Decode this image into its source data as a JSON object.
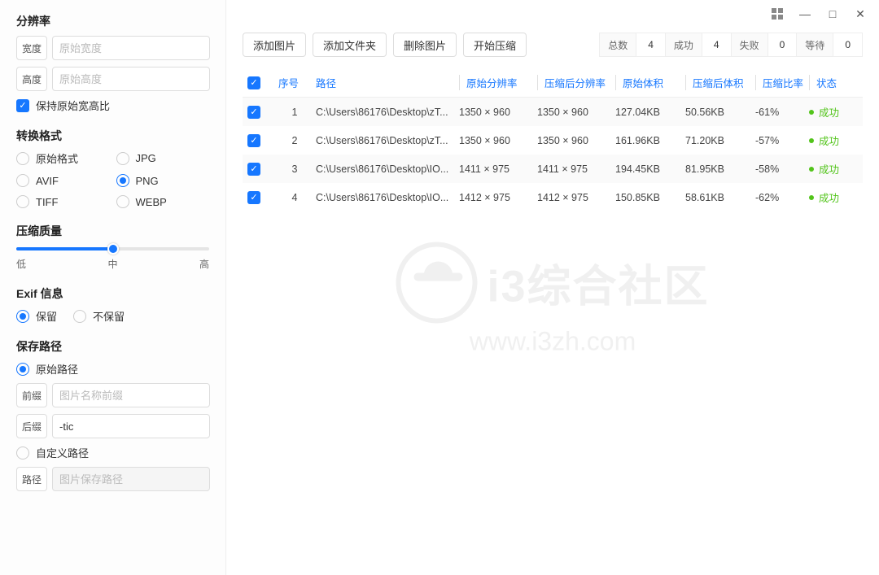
{
  "sidebar": {
    "resolution": {
      "title": "分辨率",
      "width_label": "宽度",
      "width_placeholder": "原始宽度",
      "height_label": "高度",
      "height_placeholder": "原始高度",
      "keep_ratio": "保持原始宽高比"
    },
    "format": {
      "title": "转换格式",
      "options": [
        "原始格式",
        "JPG",
        "AVIF",
        "PNG",
        "TIFF",
        "WEBP"
      ],
      "selected": "PNG"
    },
    "quality": {
      "title": "压缩质量",
      "low": "低",
      "mid": "中",
      "high": "高"
    },
    "exif": {
      "title": "Exif 信息",
      "keep": "保留",
      "discard": "不保留",
      "selected": "保留"
    },
    "save": {
      "title": "保存路径",
      "original": "原始路径",
      "prefix_label": "前缀",
      "prefix_placeholder": "图片名称前缀",
      "suffix_label": "后缀",
      "suffix_value": "-tic",
      "custom": "自定义路径",
      "path_label": "路径",
      "path_placeholder": "图片保存路径",
      "selected": "原始路径"
    }
  },
  "toolbar": {
    "add_image": "添加图片",
    "add_folder": "添加文件夹",
    "delete_image": "删除图片",
    "start": "开始压缩"
  },
  "stats": {
    "total_label": "总数",
    "total_val": "4",
    "success_label": "成功",
    "success_val": "4",
    "fail_label": "失败",
    "fail_val": "0",
    "wait_label": "等待",
    "wait_val": "0"
  },
  "table": {
    "headers": {
      "index": "序号",
      "path": "路径",
      "orig_res": "原始分辨率",
      "comp_res": "压缩后分辨率",
      "orig_size": "原始体积",
      "comp_size": "压缩后体积",
      "ratio": "压缩比率",
      "status": "状态"
    },
    "rows": [
      {
        "idx": "1",
        "path": "C:\\Users\\86176\\Desktop\\zT...",
        "ores": "1350 × 960",
        "cres": "1350 × 960",
        "osize": "127.04KB",
        "csize": "50.56KB",
        "ratio": "-61%",
        "status": "成功"
      },
      {
        "idx": "2",
        "path": "C:\\Users\\86176\\Desktop\\zT...",
        "ores": "1350 × 960",
        "cres": "1350 × 960",
        "osize": "161.96KB",
        "csize": "71.20KB",
        "ratio": "-57%",
        "status": "成功"
      },
      {
        "idx": "3",
        "path": "C:\\Users\\86176\\Desktop\\IO...",
        "ores": "1411 × 975",
        "cres": "1411 × 975",
        "osize": "194.45KB",
        "csize": "81.95KB",
        "ratio": "-58%",
        "status": "成功"
      },
      {
        "idx": "4",
        "path": "C:\\Users\\86176\\Desktop\\IO...",
        "ores": "1412 × 975",
        "cres": "1412 × 975",
        "osize": "150.85KB",
        "csize": "58.61KB",
        "ratio": "-62%",
        "status": "成功"
      }
    ]
  },
  "watermark": {
    "title": "i3综合社区",
    "url": "www.i3zh.com"
  }
}
